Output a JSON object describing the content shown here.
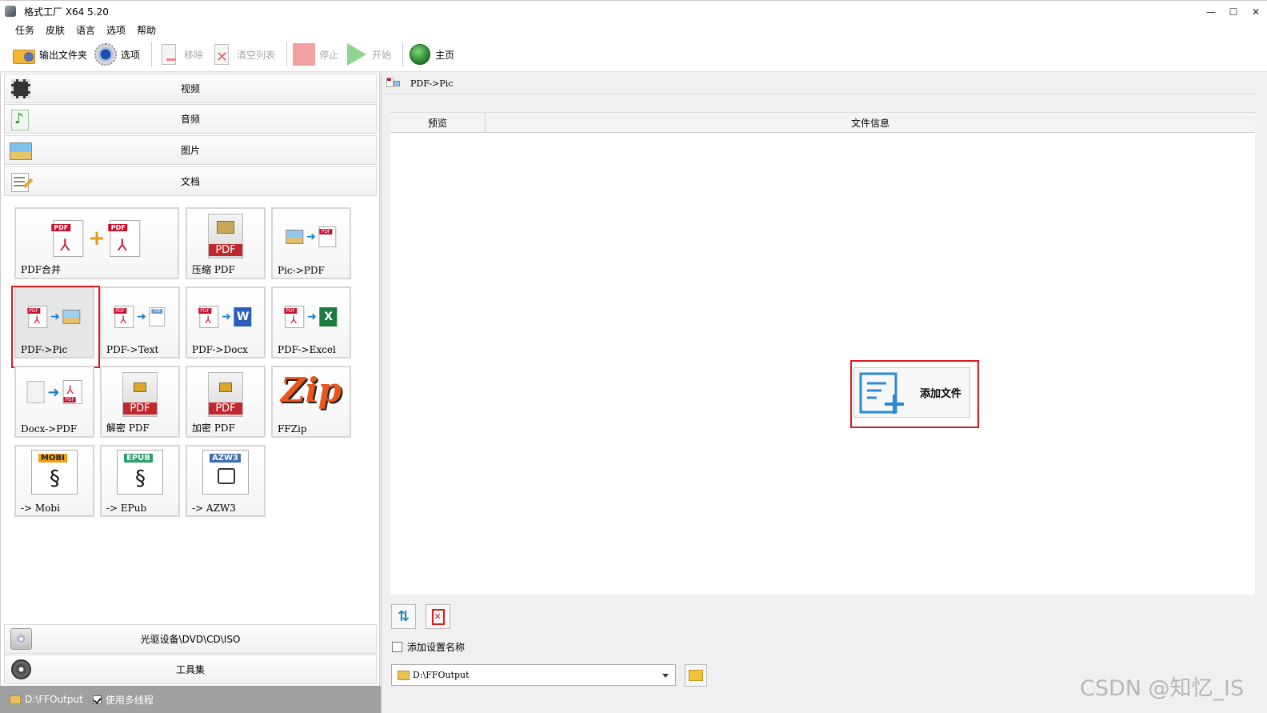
{
  "window": {
    "title": "格式工厂 X64 5.20",
    "controls": {
      "minimize": "—",
      "maximize": "☐",
      "close": "✕"
    }
  },
  "menu": [
    "任务",
    "皮肤",
    "语言",
    "选项",
    "帮助"
  ],
  "toolbar": {
    "output_folder": "输出文件夹",
    "options": "选项",
    "remove": "移除",
    "clear_list": "清空列表",
    "stop": "停止",
    "start": "开始",
    "home": "主页"
  },
  "categories": {
    "video": "视频",
    "audio": "音频",
    "picture": "图片",
    "document": "文档",
    "optical": "光驱设备\\DVD\\CD\\ISO",
    "toolbox": "工具集"
  },
  "tiles": {
    "pdf_merge": "PDF合并",
    "compress_pdf": "压缩 PDF",
    "pic_to_pdf": "Pic->PDF",
    "pdf_to_pic": "PDF->Pic",
    "pdf_to_text": "PDF->Text",
    "pdf_to_docx": "PDF->Docx",
    "pdf_to_excel": "PDF->Excel",
    "docx_to_pdf": "Docx->PDF",
    "decrypt_pdf": "解密 PDF",
    "encrypt_pdf": "加密 PDF",
    "ffzip": "FFZip",
    "to_mobi": "-> Mobi",
    "to_epub": "-> EPub",
    "to_azw3": "-> AZW3"
  },
  "tile_badges": {
    "mobi": "MOBI",
    "epub": "EPUB",
    "azw3": "AZW3",
    "pdf": "PDF",
    "txt": "TXT",
    "word": "W",
    "excel": "X"
  },
  "status": {
    "output_path": "D:\\FFOutput",
    "multithread": "使用多线程"
  },
  "panel": {
    "title": "PDF->Pic",
    "col_preview": "预览",
    "col_info": "文件信息",
    "add_file": "添加文件",
    "add_setting_name": "添加设置名称",
    "output_dir": "D:\\FFOutput"
  },
  "watermark": "CSDN @知忆_IS",
  "colors": {
    "highlight_red": "#e0191e",
    "pdf_red": "#c8102e",
    "add_icon_blue": "#2a8ad4"
  }
}
